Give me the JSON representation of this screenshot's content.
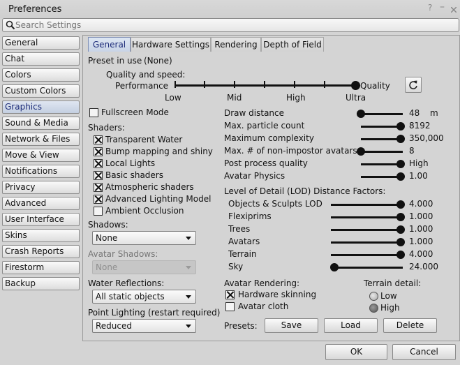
{
  "window": {
    "title": "Preferences",
    "help_glyph": "?",
    "min_glyph": "–"
  },
  "search": {
    "placeholder": "Search Settings"
  },
  "sidebar": {
    "items": [
      {
        "label": "General"
      },
      {
        "label": "Chat"
      },
      {
        "label": "Colors"
      },
      {
        "label": "Custom Colors"
      },
      {
        "label": "Graphics"
      },
      {
        "label": "Sound & Media"
      },
      {
        "label": "Network & Files"
      },
      {
        "label": "Move & View"
      },
      {
        "label": "Notifications"
      },
      {
        "label": "Privacy"
      },
      {
        "label": "Advanced"
      },
      {
        "label": "User Interface"
      },
      {
        "label": "Skins"
      },
      {
        "label": "Crash Reports"
      },
      {
        "label": "Firestorm"
      },
      {
        "label": "Backup"
      }
    ],
    "selected": "Graphics"
  },
  "tabs": [
    {
      "label": "General"
    },
    {
      "label": "Hardware Settings"
    },
    {
      "label": "Rendering"
    },
    {
      "label": "Depth of Field"
    }
  ],
  "preset": {
    "label": "Preset in use",
    "value": "(None)"
  },
  "quality": {
    "title": "Quality and speed:",
    "left": "Performance",
    "right": "Quality",
    "ticks": [
      "Low",
      "Mid",
      "High",
      "Ultra"
    ],
    "level": 1.0
  },
  "fullscreen": {
    "label": "Fullscreen Mode",
    "checked": false
  },
  "shaders": {
    "title": "Shaders:",
    "items": [
      {
        "label": "Transparent Water",
        "checked": true
      },
      {
        "label": "Bump mapping and shiny",
        "checked": true
      },
      {
        "label": "Local Lights",
        "checked": true
      },
      {
        "label": "Basic shaders",
        "checked": true
      },
      {
        "label": "Atmospheric shaders",
        "checked": true
      },
      {
        "label": "Advanced Lighting Model",
        "checked": true
      },
      {
        "label": "Ambient Occlusion",
        "checked": false
      }
    ]
  },
  "shadows": {
    "label": "Shadows:",
    "value": "None"
  },
  "avatar_shadows": {
    "label": "Avatar Shadows:",
    "value": "None"
  },
  "water_reflections": {
    "label": "Water Reflections:",
    "value": "All static objects"
  },
  "point_lighting": {
    "label": "Point Lighting (restart required)",
    "value": "Reduced"
  },
  "right_sliders": [
    {
      "label": "Draw distance",
      "value": "48",
      "unit": "m",
      "level": 0.0
    },
    {
      "label": "Max. particle count",
      "value": "8192",
      "level": 1.0
    },
    {
      "label": "Maximum complexity",
      "value": "350,000",
      "level": 1.0
    },
    {
      "label": "Max. # of non-impostor avatars",
      "value": "8",
      "level": 0.0
    },
    {
      "label": "Post process quality",
      "value": "High",
      "level": 1.0
    },
    {
      "label": "Avatar Physics",
      "value": "1.00",
      "level": 1.0
    }
  ],
  "lod": {
    "title": "Level of Detail (LOD) Distance Factors:",
    "items": [
      {
        "label": "Objects & Sculpts LOD",
        "value": "4.000",
        "level": 1.0
      },
      {
        "label": "Flexiprims",
        "value": "1.000",
        "level": 1.0
      },
      {
        "label": "Trees",
        "value": "1.000",
        "level": 1.0
      },
      {
        "label": "Avatars",
        "value": "1.000",
        "level": 1.0
      },
      {
        "label": "Terrain",
        "value": "4.000",
        "level": 1.0
      },
      {
        "label": "Sky",
        "value": "24.000",
        "level": 0.0
      }
    ]
  },
  "avatar_rendering": {
    "title": "Avatar Rendering:",
    "items": [
      {
        "label": "Hardware skinning",
        "checked": true
      },
      {
        "label": "Avatar cloth",
        "checked": false
      }
    ]
  },
  "terrain_detail": {
    "title": "Terrain detail:",
    "options": [
      {
        "label": "Low",
        "selected": false
      },
      {
        "label": "High",
        "selected": true
      }
    ]
  },
  "presets": {
    "label": "Presets:",
    "save": "Save",
    "load": "Load",
    "delete": "Delete"
  },
  "footer": {
    "ok": "OK",
    "cancel": "Cancel"
  }
}
